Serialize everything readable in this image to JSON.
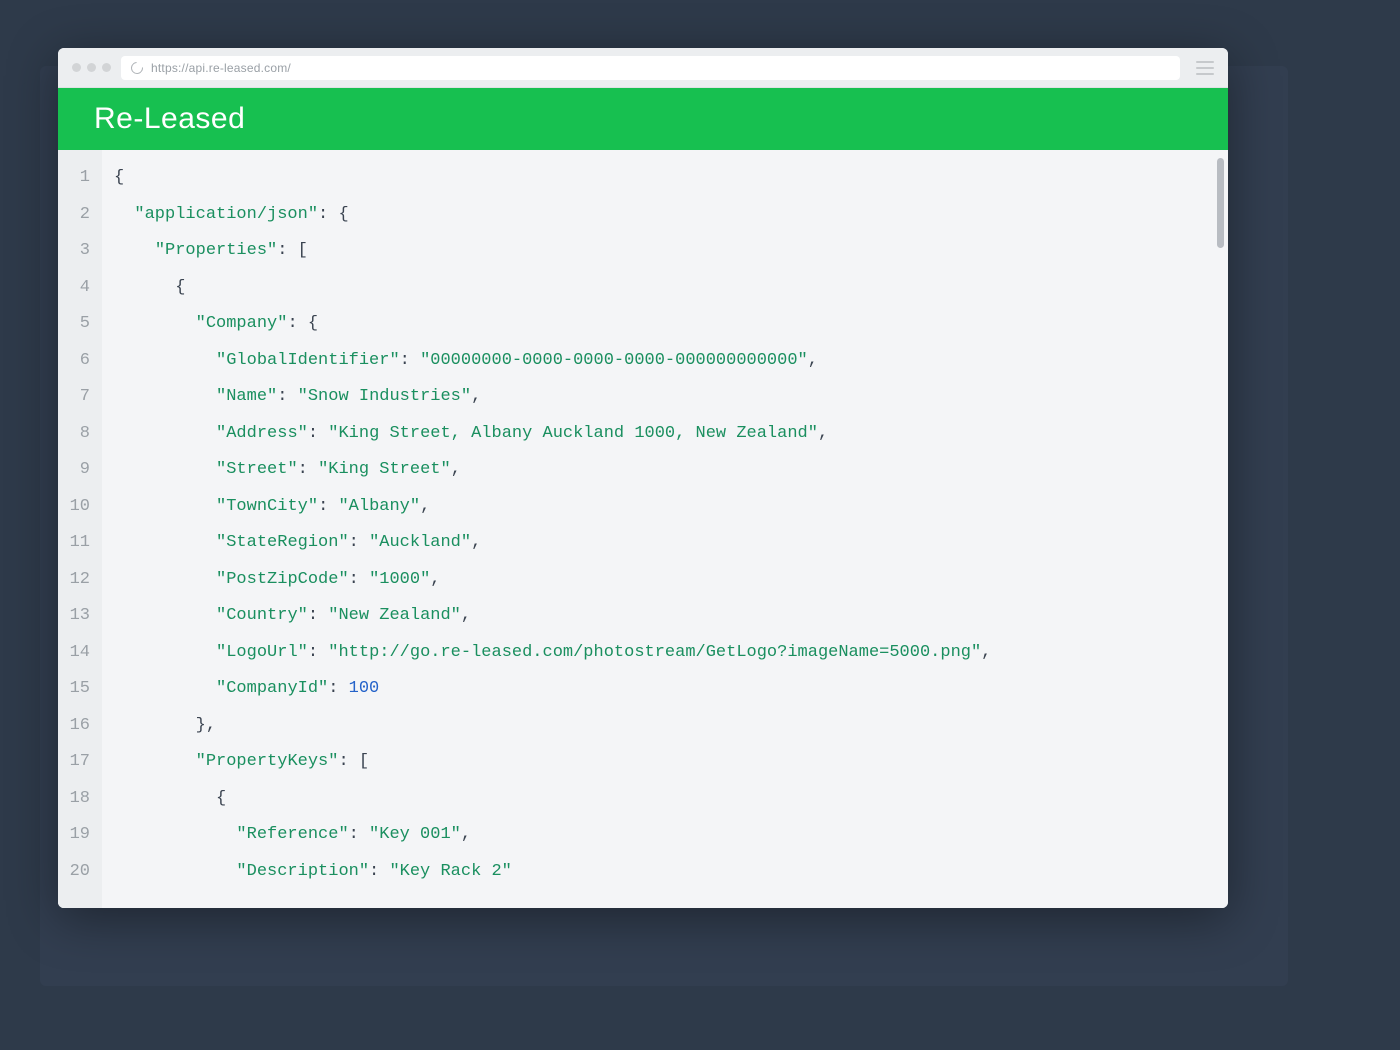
{
  "browser": {
    "url": "https://api.re-leased.com/"
  },
  "header": {
    "title": "Re-Leased"
  },
  "code": {
    "lines": [
      {
        "num": "1",
        "indent": 0,
        "tokens": [
          {
            "t": "punct",
            "v": "{"
          }
        ]
      },
      {
        "num": "2",
        "indent": 1,
        "tokens": [
          {
            "t": "key",
            "v": "\"application/json\""
          },
          {
            "t": "punct",
            "v": ": {"
          }
        ]
      },
      {
        "num": "3",
        "indent": 2,
        "tokens": [
          {
            "t": "key",
            "v": "\"Properties\""
          },
          {
            "t": "punct",
            "v": ": ["
          }
        ]
      },
      {
        "num": "4",
        "indent": 3,
        "tokens": [
          {
            "t": "punct",
            "v": "{"
          }
        ]
      },
      {
        "num": "5",
        "indent": 4,
        "tokens": [
          {
            "t": "key",
            "v": "\"Company\""
          },
          {
            "t": "punct",
            "v": ": {"
          }
        ]
      },
      {
        "num": "6",
        "indent": 5,
        "tokens": [
          {
            "t": "key",
            "v": "\"GlobalIdentifier\""
          },
          {
            "t": "punct",
            "v": ": "
          },
          {
            "t": "str",
            "v": "\"00000000-0000-0000-0000-000000000000\""
          },
          {
            "t": "punct",
            "v": ","
          }
        ]
      },
      {
        "num": "7",
        "indent": 5,
        "tokens": [
          {
            "t": "key",
            "v": "\"Name\""
          },
          {
            "t": "punct",
            "v": ": "
          },
          {
            "t": "str",
            "v": "\"Snow Industries\""
          },
          {
            "t": "punct",
            "v": ","
          }
        ]
      },
      {
        "num": "8",
        "indent": 5,
        "tokens": [
          {
            "t": "key",
            "v": "\"Address\""
          },
          {
            "t": "punct",
            "v": ": "
          },
          {
            "t": "str",
            "v": "\"King Street, Albany Auckland 1000, New Zealand\""
          },
          {
            "t": "punct",
            "v": ","
          }
        ]
      },
      {
        "num": "9",
        "indent": 5,
        "tokens": [
          {
            "t": "key",
            "v": "\"Street\""
          },
          {
            "t": "punct",
            "v": ": "
          },
          {
            "t": "str",
            "v": "\"King Street\""
          },
          {
            "t": "punct",
            "v": ","
          }
        ]
      },
      {
        "num": "10",
        "indent": 5,
        "tokens": [
          {
            "t": "key",
            "v": "\"TownCity\""
          },
          {
            "t": "punct",
            "v": ": "
          },
          {
            "t": "str",
            "v": "\"Albany\""
          },
          {
            "t": "punct",
            "v": ","
          }
        ]
      },
      {
        "num": "11",
        "indent": 5,
        "tokens": [
          {
            "t": "key",
            "v": "\"StateRegion\""
          },
          {
            "t": "punct",
            "v": ": "
          },
          {
            "t": "str",
            "v": "\"Auckland\""
          },
          {
            "t": "punct",
            "v": ","
          }
        ]
      },
      {
        "num": "12",
        "indent": 5,
        "tokens": [
          {
            "t": "key",
            "v": "\"PostZipCode\""
          },
          {
            "t": "punct",
            "v": ": "
          },
          {
            "t": "str",
            "v": "\"1000\""
          },
          {
            "t": "punct",
            "v": ","
          }
        ]
      },
      {
        "num": "13",
        "indent": 5,
        "tokens": [
          {
            "t": "key",
            "v": "\"Country\""
          },
          {
            "t": "punct",
            "v": ": "
          },
          {
            "t": "str",
            "v": "\"New Zealand\""
          },
          {
            "t": "punct",
            "v": ","
          }
        ]
      },
      {
        "num": "14",
        "indent": 5,
        "tokens": [
          {
            "t": "key",
            "v": "\"LogoUrl\""
          },
          {
            "t": "punct",
            "v": ": "
          },
          {
            "t": "str",
            "v": "\"http://go.re-leased.com/photostream/GetLogo?imageName=5000.png\""
          },
          {
            "t": "punct",
            "v": ","
          }
        ]
      },
      {
        "num": "15",
        "indent": 5,
        "tokens": [
          {
            "t": "key",
            "v": "\"CompanyId\""
          },
          {
            "t": "punct",
            "v": ": "
          },
          {
            "t": "num",
            "v": "100"
          }
        ]
      },
      {
        "num": "16",
        "indent": 4,
        "tokens": [
          {
            "t": "punct",
            "v": "},"
          }
        ]
      },
      {
        "num": "17",
        "indent": 4,
        "tokens": [
          {
            "t": "key",
            "v": "\"PropertyKeys\""
          },
          {
            "t": "punct",
            "v": ": ["
          }
        ]
      },
      {
        "num": "18",
        "indent": 5,
        "tokens": [
          {
            "t": "punct",
            "v": "{"
          }
        ]
      },
      {
        "num": "19",
        "indent": 6,
        "tokens": [
          {
            "t": "key",
            "v": "\"Reference\""
          },
          {
            "t": "punct",
            "v": ": "
          },
          {
            "t": "str",
            "v": "\"Key 001\""
          },
          {
            "t": "punct",
            "v": ","
          }
        ]
      },
      {
        "num": "20",
        "indent": 6,
        "tokens": [
          {
            "t": "key",
            "v": "\"Description\""
          },
          {
            "t": "punct",
            "v": ": "
          },
          {
            "t": "str",
            "v": "\"Key Rack 2\""
          }
        ]
      }
    ]
  }
}
